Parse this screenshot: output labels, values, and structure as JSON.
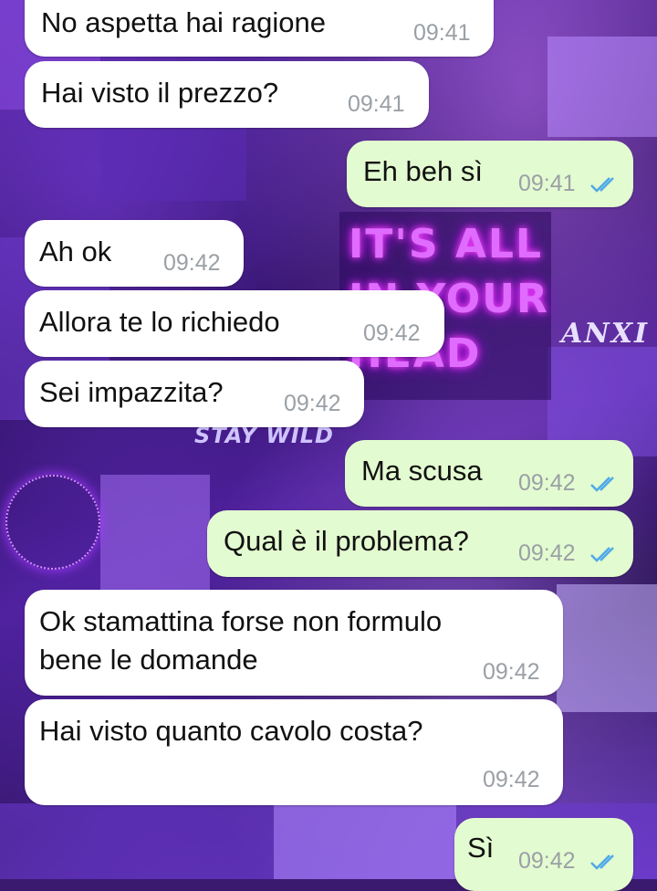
{
  "wallpaper": {
    "neon_lines": [
      "IT'S ALL",
      "IN YOUR",
      "HEAD"
    ],
    "sign_anx": "ANXI",
    "sign_stay": "STAY WILD"
  },
  "colors": {
    "incoming_bubble": "#ffffff",
    "outgoing_bubble": "#e3fbd0",
    "read_ticks": "#4fa9e8",
    "timestamp": "#9aa0a6"
  },
  "messages": [
    {
      "dir": "in",
      "text": "No aspetta hai ragione",
      "time": "09:41"
    },
    {
      "dir": "in",
      "text": "Hai visto il prezzo?",
      "time": "09:41"
    },
    {
      "dir": "out",
      "text": "Eh beh sì",
      "time": "09:41",
      "status": "read-ticks-icon"
    },
    {
      "dir": "in",
      "text": "Ah ok",
      "time": "09:42"
    },
    {
      "dir": "in",
      "text": "Allora te lo richiedo",
      "time": "09:42"
    },
    {
      "dir": "in",
      "text": "Sei impazzita?",
      "time": "09:42"
    },
    {
      "dir": "out",
      "text": "Ma scusa",
      "time": "09:42",
      "status": "read-ticks-icon"
    },
    {
      "dir": "out",
      "text": "Qual è il problema?",
      "time": "09:42",
      "status": "read-ticks-icon"
    },
    {
      "dir": "in",
      "text_lines": [
        "Ok stamattina forse non formulo",
        "bene le domande"
      ],
      "time": "09:42"
    },
    {
      "dir": "in",
      "text": "Hai visto quanto cavolo costa?",
      "time": "09:42"
    },
    {
      "dir": "out",
      "text": "Sì",
      "time": "09:42",
      "status": "read-ticks-icon"
    }
  ]
}
